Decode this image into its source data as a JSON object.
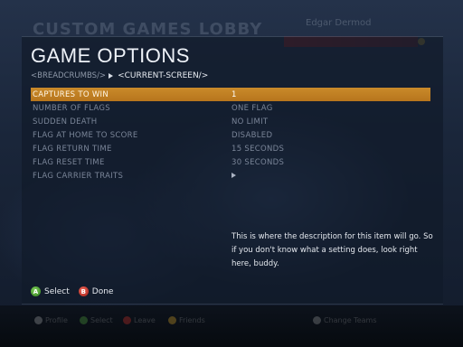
{
  "background": {
    "lobby_title": "CUSTOM GAMES LOBBY",
    "lobby_right_text": "Edgar Dermod",
    "footer_items": [
      "Profile",
      "Select",
      "Leave",
      "Friends"
    ],
    "footer_right": "Change Teams"
  },
  "dialog": {
    "title": "GAME OPTIONS",
    "breadcrumbs": "<BREADCRUMBS/>",
    "current_screen": "<CURRENT-SCREEN/>"
  },
  "options": [
    {
      "label": "CAPTURES TO WIN",
      "value": "1"
    },
    {
      "label": "NUMBER OF FLAGS",
      "value": "ONE FLAG"
    },
    {
      "label": "SUDDEN DEATH",
      "value": "NO LIMIT"
    },
    {
      "label": "FLAG AT HOME TO SCORE",
      "value": "DISABLED"
    },
    {
      "label": "FLAG RETURN TIME",
      "value": "15 SECONDS"
    },
    {
      "label": "FLAG RESET TIME",
      "value": "30 SECONDS"
    },
    {
      "label": "FLAG CARRIER TRAITS",
      "value": ""
    }
  ],
  "selected_index": 0,
  "description": "This is where the description for this item will go. So if you don't know what a setting does, look right here, buddy.",
  "hints": {
    "a_glyph": "A",
    "a_label": "Select",
    "b_glyph": "B",
    "b_label": "Done"
  },
  "colors": {
    "selection": "#c98a2a",
    "button_a": "#4aa32c",
    "button_b": "#d0342a"
  }
}
